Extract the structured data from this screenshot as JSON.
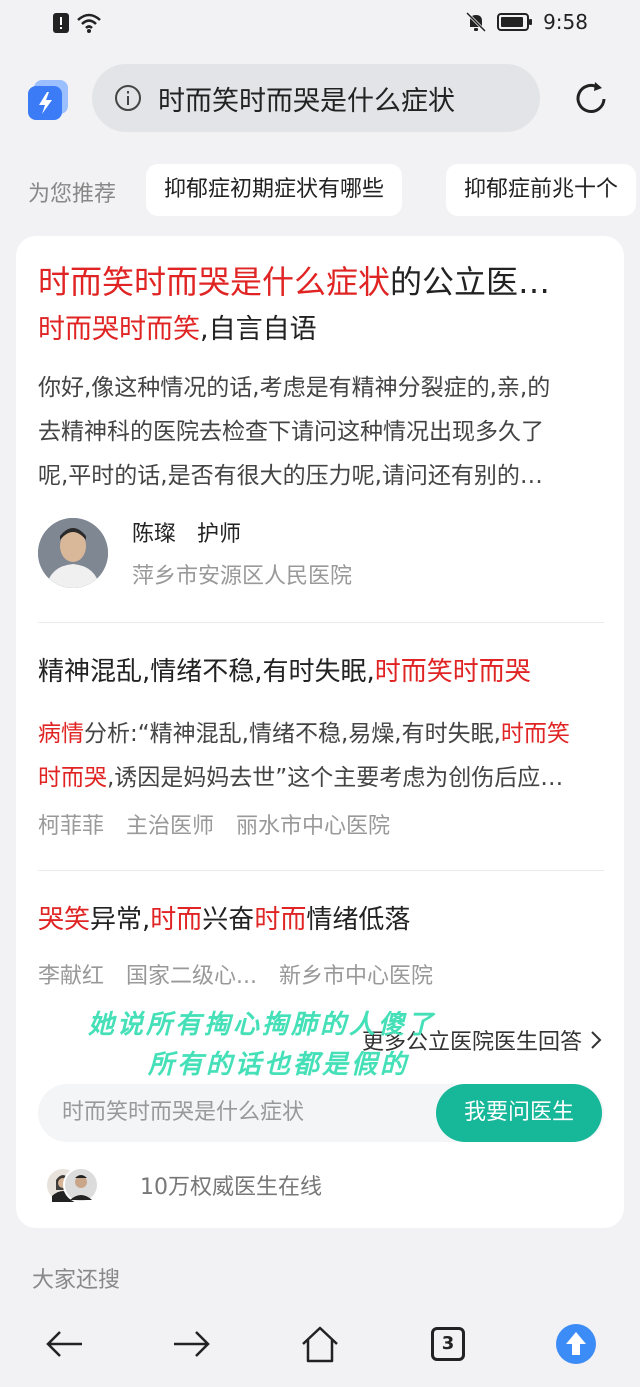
{
  "status_bar": {
    "time": "9:58"
  },
  "address_bar": {
    "query": "时而笑时而哭是什么症状"
  },
  "recommend": {
    "label": "为您推荐",
    "chips": [
      "抑郁症初期症状有哪些",
      "抑郁症前兆十个"
    ]
  },
  "result1": {
    "title_hl": "时而笑时而哭是什么症状",
    "title_rest": "的公立医…",
    "sub_hl": "时而哭时而笑",
    "sub_rest": ",自言自语",
    "snippet_lines": [
      "你好,像这种情况的话,考虑是有精神分裂症的,亲,的",
      "去精神科的医院去检查下请问这种情况出现多久了",
      "呢,平时的话,是否有很大的压力呢,请问还有别的…"
    ],
    "doctor": "陈璨   护师",
    "hospital": "萍乡市安源区人民医院"
  },
  "result2": {
    "title_plain": "精神混乱,情绪不稳,有时失眠,",
    "title_hl": "时而笑时而哭",
    "line1_hl": "病情",
    "line1_plain": "分析:“精神混乱,情绪不稳,易燥,有时失眠,",
    "line1_hl2": "时而笑",
    "line2_hl": "时而哭",
    "line2_plain": ",诱因是妈妈去世”这个主要考虑为创伤后应…",
    "meta": [
      "柯菲菲",
      "主治医师",
      "丽水市中心医院"
    ]
  },
  "result3": {
    "hl1": "哭笑",
    "p1": "异常,",
    "hl2": "时而",
    "p2": "兴奋",
    "hl3": "时而",
    "p3": "情绪低落",
    "meta": [
      "李献红",
      "国家二级心...",
      "新乡市中心医院"
    ]
  },
  "overlay": {
    "line1": "她说所有掏心掏肺的人傻了",
    "line2": "所有的话也都是假的"
  },
  "more_link": "更多公立医院医生回答",
  "ask": {
    "placeholder": "时而笑时而哭是什么症状",
    "button": "我要问医生",
    "online": "10万权威医生在线"
  },
  "also_search": "大家还搜",
  "nav": {
    "tab_count": "3"
  },
  "colors": {
    "highlight": "#e02424",
    "accent": "#17b79a",
    "overlay": "#45e0b8",
    "brand": "#3b7bf6"
  }
}
